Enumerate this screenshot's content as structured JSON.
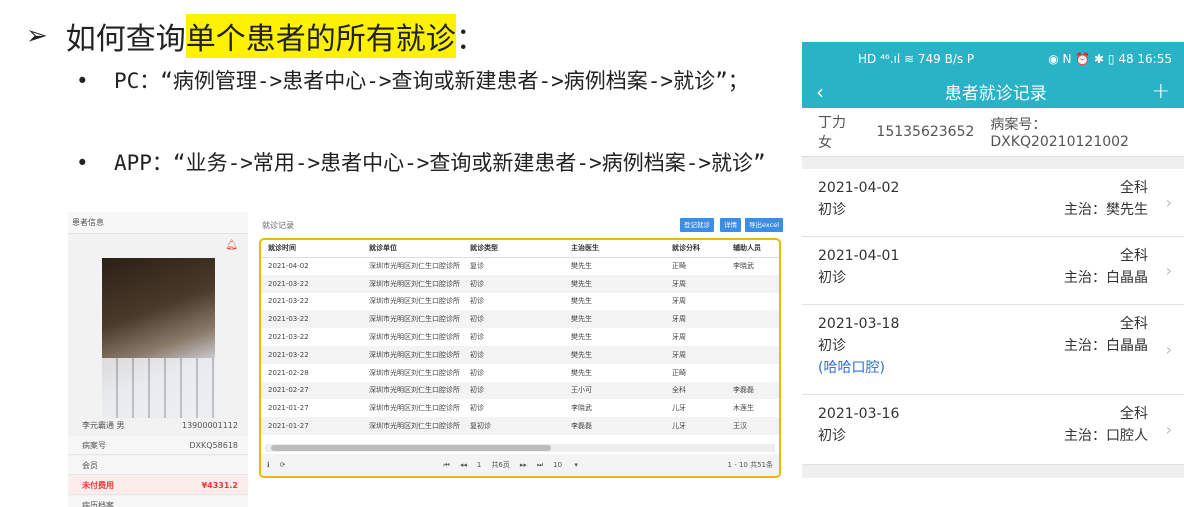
{
  "slide": {
    "arrow": "➢",
    "heading_prefix": "如何查询",
    "heading_highlight": "单个患者的所有就诊",
    "heading_suffix": "：",
    "bullets": [
      "PC：“病例管理->患者中心->查询或新建患者->病例档案->就诊”；",
      "APP：“业务->常用->患者中心->查询或新建患者->病例档案->就诊”"
    ]
  },
  "pc": {
    "left_panel": {
      "header": "患者信息",
      "name": "李元霸通 男",
      "phone": "13900001112",
      "rows": [
        {
          "label": "病案号",
          "value": "DXKQ58618"
        },
        {
          "label": "会员",
          "value": ""
        },
        {
          "label": "未付费用",
          "value": "¥4331.2"
        },
        {
          "label": "病历档案",
          "value": ""
        }
      ]
    },
    "main": {
      "title": "就诊记录",
      "buttons": [
        "登记就诊",
        "详情",
        "导出excel"
      ],
      "columns": [
        "就诊时间",
        "就诊单位",
        "就诊类型",
        "主治医生",
        "就诊分科",
        "辅助人员"
      ],
      "rows": [
        [
          "2021-04-02",
          "深圳市光明区刘仁生口腔诊所",
          "复诊",
          "樊先生",
          "正畸",
          "李晓武"
        ],
        [
          "2021-03-22",
          "深圳市光明区刘仁生口腔诊所",
          "初诊",
          "樊先生",
          "牙周",
          ""
        ],
        [
          "2021-03-22",
          "深圳市光明区刘仁生口腔诊所",
          "初诊",
          "樊先生",
          "牙周",
          ""
        ],
        [
          "2021-03-22",
          "深圳市光明区刘仁生口腔诊所",
          "初诊",
          "樊先生",
          "牙周",
          ""
        ],
        [
          "2021-03-22",
          "深圳市光明区刘仁生口腔诊所",
          "初诊",
          "樊先生",
          "牙周",
          ""
        ],
        [
          "2021-03-22",
          "深圳市光明区刘仁生口腔诊所",
          "初诊",
          "樊先生",
          "牙周",
          ""
        ],
        [
          "2021-02-28",
          "深圳市光明区刘仁生口腔诊所",
          "初诊",
          "樊先生",
          "正畸",
          ""
        ],
        [
          "2021-02-27",
          "深圳市光明区刘仁生口腔诊所",
          "初诊",
          "王小可",
          "全科",
          "李磊磊"
        ],
        [
          "2021-01-27",
          "深圳市光明区刘仁生口腔诊所",
          "初诊",
          "李晓武",
          "儿牙",
          "木莲生"
        ],
        [
          "2021-01-27",
          "深圳市光明区刘仁生口腔诊所",
          "复初诊",
          "李磊磊",
          "儿牙",
          "王汉"
        ]
      ],
      "pager": {
        "page": "1",
        "total_pages": "共6页",
        "page_size": "10",
        "summary": "1 - 10 共51条"
      }
    }
  },
  "phone": {
    "status_left": "HD ⁴⁶.ıl ≋ 749 B/s P",
    "status_right": "◉ N ⏰ ✱ ▯ 48 16:55",
    "title": "患者就诊记录",
    "patient_name": "丁力 女",
    "patient_phone": "15135623652",
    "patient_case": "病案号：DXKQ20210121002",
    "visits": [
      {
        "date": "2021-04-02",
        "dept": "全科",
        "type": "初诊",
        "doctor": "主治：樊先生",
        "extra": ""
      },
      {
        "date": "2021-04-01",
        "dept": "全科",
        "type": "初诊",
        "doctor": "主治：白晶晶",
        "extra": ""
      },
      {
        "date": "2021-03-18",
        "dept": "全科",
        "type": "初诊",
        "doctor": "主治：白晶晶",
        "extra": "(哈哈口腔)"
      },
      {
        "date": "2021-03-16",
        "dept": "全科",
        "type": "初诊",
        "doctor": "主治：口腔人",
        "extra": ""
      }
    ]
  }
}
